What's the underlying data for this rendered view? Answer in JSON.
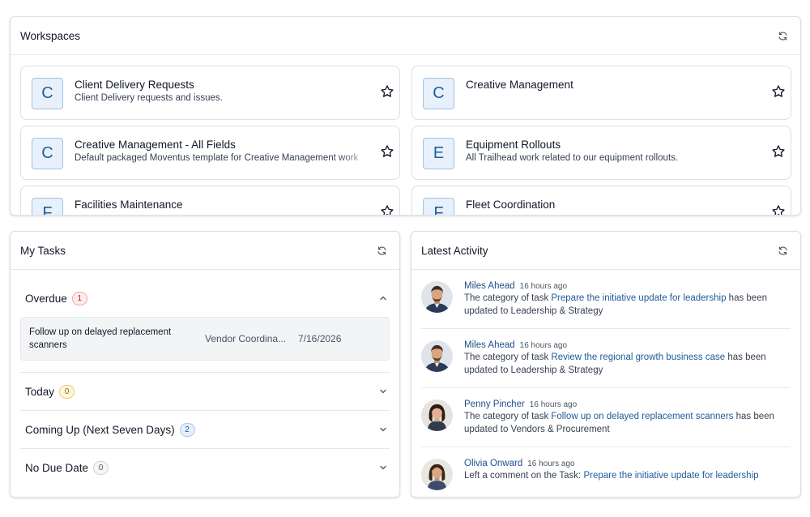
{
  "workspaces": {
    "title": "Workspaces",
    "items": [
      {
        "letter": "C",
        "name": "Client Delivery Requests",
        "desc": "Client Delivery requests and issues."
      },
      {
        "letter": "C",
        "name": "Creative Management",
        "desc": ""
      },
      {
        "letter": "C",
        "name": "Creative Management - All Fields",
        "desc": "Default packaged Moventus template for Creative Management work"
      },
      {
        "letter": "E",
        "name": "Equipment Rollouts",
        "desc": "All Trailhead work related to our equipment rollouts."
      },
      {
        "letter": "F",
        "name": "Facilities Maintenance",
        "desc": ""
      },
      {
        "letter": "F",
        "name": "Fleet Coordination",
        "desc": ""
      }
    ]
  },
  "tasks": {
    "title": "My Tasks",
    "sections": [
      {
        "label": "Overdue",
        "count": "1",
        "expanded": true
      },
      {
        "label": "Today",
        "count": "0",
        "expanded": false
      },
      {
        "label": "Coming Up (Next Seven Days)",
        "count": "2",
        "expanded": false
      },
      {
        "label": "No Due Date",
        "count": "0",
        "expanded": false
      }
    ],
    "overdue_task": {
      "name": "Follow up on delayed replacement scanners",
      "workspace": "Vendor Coordina...",
      "date": "7/16/2026"
    }
  },
  "activity": {
    "title": "Latest Activity",
    "items": [
      {
        "user": "Miles Ahead",
        "time": "16 hours ago",
        "pre": "The category of task ",
        "link": "Prepare the initiative update for leadership",
        "post": " has been updated to Leadership & Strategy"
      },
      {
        "user": "Miles Ahead",
        "time": "16 hours ago",
        "pre": "The category of task ",
        "link": "Review the regional growth business case",
        "post": " has been updated to Leadership & Strategy"
      },
      {
        "user": "Penny Pincher",
        "time": "16 hours ago",
        "pre": "The category of task ",
        "link": "Follow up on delayed replacement scanners",
        "post": " has been updated to Vendors & Procurement"
      },
      {
        "user": "Olivia Onward",
        "time": "16 hours ago",
        "pre": "Left a comment on the Task: ",
        "link": "Prepare the initiative update for leadership",
        "post": ""
      }
    ]
  },
  "colors": {
    "accent": "#1e5a99",
    "avatar_bg": "#e8f1fb"
  }
}
